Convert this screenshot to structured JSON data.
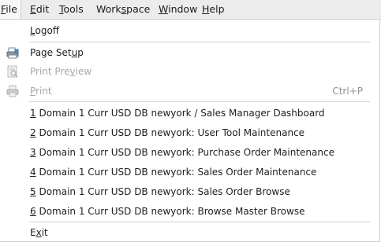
{
  "menubar": {
    "items": [
      {
        "name": "File",
        "mn": "F",
        "rest": "ile"
      },
      {
        "name": "Edit",
        "mn": "E",
        "rest": "dit"
      },
      {
        "name": "Tools",
        "mn": "T",
        "rest": "ools"
      },
      {
        "name": "Workspace",
        "pre": "Work",
        "mn": "s",
        "rest": "pace"
      },
      {
        "name": "Window",
        "mn": "W",
        "rest": "indow"
      },
      {
        "name": "Help",
        "mn": "H",
        "rest": "elp"
      }
    ]
  },
  "file_menu": {
    "logoff": {
      "mn": "L",
      "rest": "ogoff"
    },
    "page_setup": {
      "pre": "Page Set",
      "mn": "u",
      "rest": "p",
      "icon": "page-setup-icon"
    },
    "print_preview": {
      "pre": "Print Pre",
      "mn": "v",
      "rest": "iew",
      "icon": "print-preview-icon"
    },
    "print": {
      "mn": "P",
      "rest": "rint",
      "shortcut": "Ctrl+P",
      "icon": "printer-icon"
    },
    "recent": [
      {
        "num": "1",
        "text": " Domain 1 Curr USD DB newyork / Sales Manager Dashboard"
      },
      {
        "num": "2",
        "text": " Domain 1 Curr USD DB newyork: User Tool Maintenance"
      },
      {
        "num": "3",
        "text": " Domain 1 Curr USD DB newyork: Purchase Order Maintenance"
      },
      {
        "num": "4",
        "text": " Domain 1 Curr USD DB newyork: Sales Order Maintenance"
      },
      {
        "num": "5",
        "text": " Domain 1 Curr USD DB newyork: Sales Order Browse"
      },
      {
        "num": "6",
        "text": " Domain 1 Curr USD DB newyork: Browse Master Browse"
      }
    ],
    "exit": {
      "pre": "E",
      "mn": "x",
      "rest": "it"
    }
  }
}
